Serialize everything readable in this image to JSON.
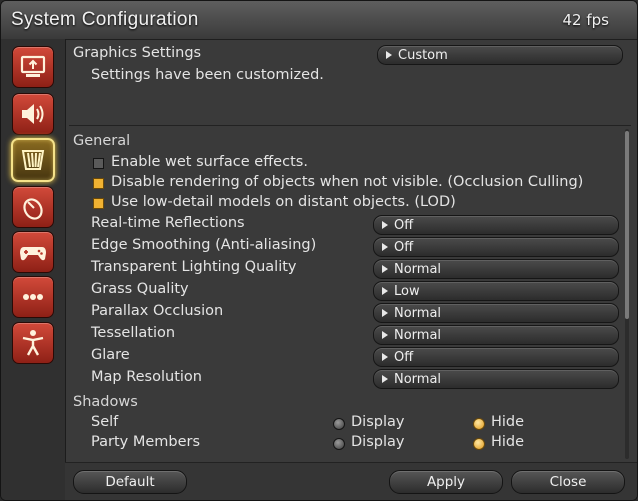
{
  "window": {
    "title": "System Configuration",
    "fps": "42 fps"
  },
  "sidebar": {
    "items": [
      {
        "icon": "display-icon",
        "active": false
      },
      {
        "icon": "sound-icon",
        "active": false
      },
      {
        "icon": "graphics-icon",
        "active": true
      },
      {
        "icon": "mouse-icon",
        "active": false
      },
      {
        "icon": "gamepad-icon",
        "active": false
      },
      {
        "icon": "more-icon",
        "active": false
      },
      {
        "icon": "accessibility-icon",
        "active": false
      }
    ]
  },
  "graphics": {
    "label": "Graphics Settings",
    "preset": "Custom",
    "note": "Settings have been customized."
  },
  "general": {
    "heading": "General",
    "checks": [
      {
        "label": "Enable wet surface effects.",
        "checked": false
      },
      {
        "label": "Disable rendering of objects when not visible. (Occlusion Culling)",
        "checked": true
      },
      {
        "label": "Use low-detail models on distant objects. (LOD)",
        "checked": true
      }
    ],
    "settings": [
      {
        "label": "Real-time Reflections",
        "value": "Off"
      },
      {
        "label": "Edge Smoothing (Anti-aliasing)",
        "value": "Off"
      },
      {
        "label": "Transparent Lighting Quality",
        "value": "Normal"
      },
      {
        "label": "Grass Quality",
        "value": "Low"
      },
      {
        "label": "Parallax Occlusion",
        "value": "Normal"
      },
      {
        "label": "Tessellation",
        "value": "Normal"
      },
      {
        "label": "Glare",
        "value": "Off"
      },
      {
        "label": "Map Resolution",
        "value": "Normal"
      }
    ]
  },
  "shadows": {
    "heading": "Shadows",
    "option_display": "Display",
    "option_hide": "Hide",
    "rows": [
      {
        "label": "Self",
        "selected": "Hide"
      },
      {
        "label": "Party Members",
        "selected": "Hide"
      }
    ]
  },
  "footer": {
    "default_label": "Default",
    "apply_label": "Apply",
    "close_label": "Close"
  },
  "colors": {
    "accent": "#f0b232",
    "side_button": "#b8392a",
    "active_glow": "#f5e28a"
  }
}
